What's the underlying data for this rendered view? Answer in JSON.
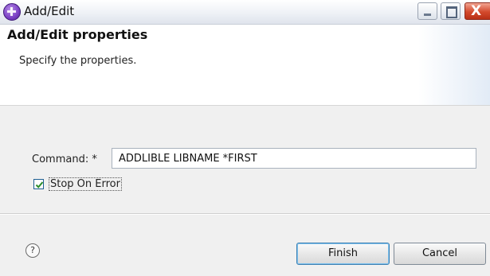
{
  "window": {
    "title": "Add/Edit",
    "controls": {
      "minimize": "_",
      "maximize": "□",
      "close": "X"
    }
  },
  "header": {
    "title": "Add/Edit properties",
    "description": "Specify the properties."
  },
  "form": {
    "command_label": "Command: *",
    "command_value": "ADDLIBLE LIBNAME *FIRST",
    "stop_on_error_label": "Stop On Error",
    "stop_on_error_checked": true
  },
  "footer": {
    "help_glyph": "?",
    "finish_label": "Finish",
    "cancel_label": "Cancel"
  },
  "icons": {
    "app": "plugin-app-icon",
    "help": "help-icon"
  },
  "colors": {
    "accent": "#3c7fb1",
    "close_button": "#d3492c"
  }
}
